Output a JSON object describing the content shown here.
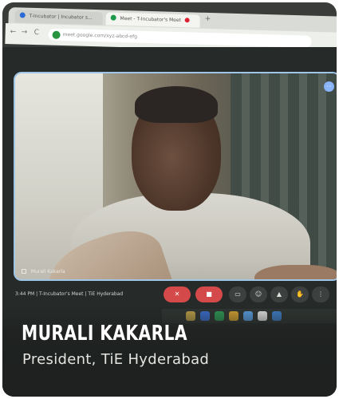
{
  "browser": {
    "tabs": [
      {
        "label": "T-Incubator | Incubator s..."
      },
      {
        "label": "Meet - T-Incubator's Meet"
      }
    ],
    "new_tab_glyph": "+",
    "address": "meet.google.com/xyz-abcd-efg",
    "nav_glyphs": {
      "back": "←",
      "forward": "→",
      "reload": "C"
    }
  },
  "meet": {
    "participant_name": "Murali Kakarla",
    "more_glyph": "⋯",
    "bottom_info": "3:44 PM  |  T-Incubator's Meet | TiE Hyderabad",
    "controls": [
      "mic-off",
      "mic-off",
      "camera-off",
      "captions",
      "emoji",
      "present",
      "raise-hand",
      "more"
    ]
  },
  "caption": {
    "name": "MURALI KAKARLA",
    "role": "President, TiE Hyderabad"
  },
  "colors": {
    "accent_blue": "#8ab4f8",
    "end_red": "#d44a4a",
    "background": "#2c2f2d"
  }
}
